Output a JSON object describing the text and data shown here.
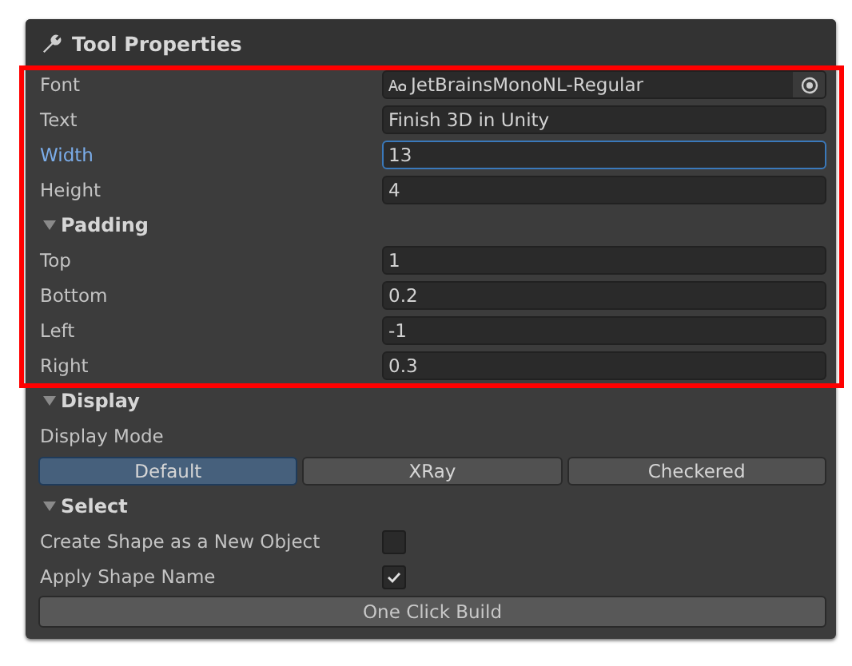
{
  "panel": {
    "title": "Tool Properties"
  },
  "highlighted_items": [
    {
      "kind": "object_field",
      "label": "Font",
      "value": "JetBrainsMonoNL-Regular",
      "focused": false
    },
    {
      "kind": "field",
      "label": "Text",
      "value": "Finish 3D in Unity",
      "focused": false
    },
    {
      "kind": "field",
      "label": "Width",
      "value": "13",
      "focused": true
    },
    {
      "kind": "field",
      "label": "Height",
      "value": "4",
      "focused": false
    },
    {
      "kind": "foldout",
      "label": "Padding",
      "expanded": true
    },
    {
      "kind": "field",
      "label": "Top",
      "value": "1",
      "focused": false
    },
    {
      "kind": "field",
      "label": "Bottom",
      "value": "0.2",
      "focused": false
    },
    {
      "kind": "field",
      "label": "Left",
      "value": "-1",
      "focused": false
    },
    {
      "kind": "field",
      "label": "Right",
      "value": "0.3",
      "focused": false
    }
  ],
  "items": [
    {
      "kind": "foldout",
      "label": "Display",
      "expanded": true
    },
    {
      "kind": "label",
      "label": "Display Mode"
    },
    {
      "kind": "segmented",
      "options": [
        {
          "label": "Default",
          "selected": true
        },
        {
          "label": "XRay",
          "selected": false
        },
        {
          "label": "Checkered",
          "selected": false
        }
      ]
    },
    {
      "kind": "foldout",
      "label": "Select",
      "expanded": true
    },
    {
      "kind": "checkbox",
      "label": "Create Shape as a New Object",
      "checked": false
    },
    {
      "kind": "checkbox",
      "label": "Apply Shape Name",
      "checked": true
    },
    {
      "kind": "button",
      "label": "One Click Build"
    }
  ]
}
